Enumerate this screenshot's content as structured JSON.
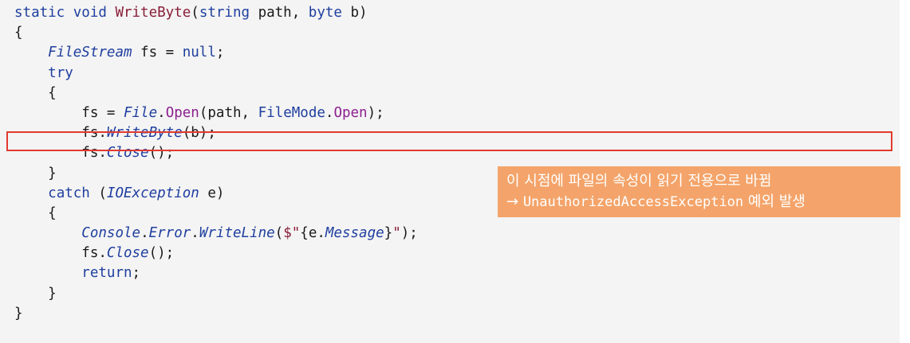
{
  "code": {
    "l1": {
      "kw1": "static void ",
      "fn": "WriteByte",
      "p1": "(",
      "kw2": "string",
      "p2": " path, ",
      "kw3": "byte",
      "p3": " b)"
    },
    "l2": "{",
    "l3": {
      "indent": "    ",
      "type": "FileStream",
      "p1": " fs = ",
      "kw": "null",
      "p2": ";"
    },
    "l4": {
      "indent": "    ",
      "kw": "try"
    },
    "l5": "    {",
    "l6": {
      "indent": "        ",
      "p1": "fs = ",
      "type": "File",
      "p2": ".",
      "m": "Open",
      "p3": "(path, ",
      "enum": "FileMode",
      "p4": ".",
      "m2": "Open",
      "p5": ");"
    },
    "l7": {
      "indent": "        ",
      "p1": "fs.",
      "m": "WriteByte",
      "p2": "(b);"
    },
    "l8": {
      "indent": "        ",
      "p1": "fs.",
      "m": "Close",
      "p2": "();"
    },
    "l9": "    }",
    "l10": {
      "indent": "    ",
      "kw": "catch",
      "p1": " (",
      "type": "IOException",
      "p2": " e)"
    },
    "l11": "    {",
    "l12": {
      "indent": "        ",
      "type": "Console",
      "p1": ".",
      "m1": "Error",
      "p2": ".",
      "m2": "WriteLine",
      "p3": "(",
      "s1": "$\"",
      "p4": "{e.",
      "m3": "Message",
      "p5": "}",
      "s2": "\"",
      "p6": ");"
    },
    "l13": {
      "indent": "        ",
      "p1": "fs.",
      "m": "Close",
      "p2": "();"
    },
    "l14": {
      "indent": "        ",
      "kw": "return",
      "p1": ";"
    },
    "l15": "    }",
    "l16": "}"
  },
  "callout": {
    "line1": "이 시점에 파일의 속성이 읽기 전용으로 바뀜",
    "arrow": "→ ",
    "exception": "UnauthorizedAccessException",
    "tail": " 예외 발생"
  },
  "colors": {
    "highlight_border": "#e23a2e",
    "callout_bg": "#f4a46a",
    "keyword": "#1f3f9f",
    "method_name": "#8a1e38",
    "member": "#8b1f8f"
  }
}
